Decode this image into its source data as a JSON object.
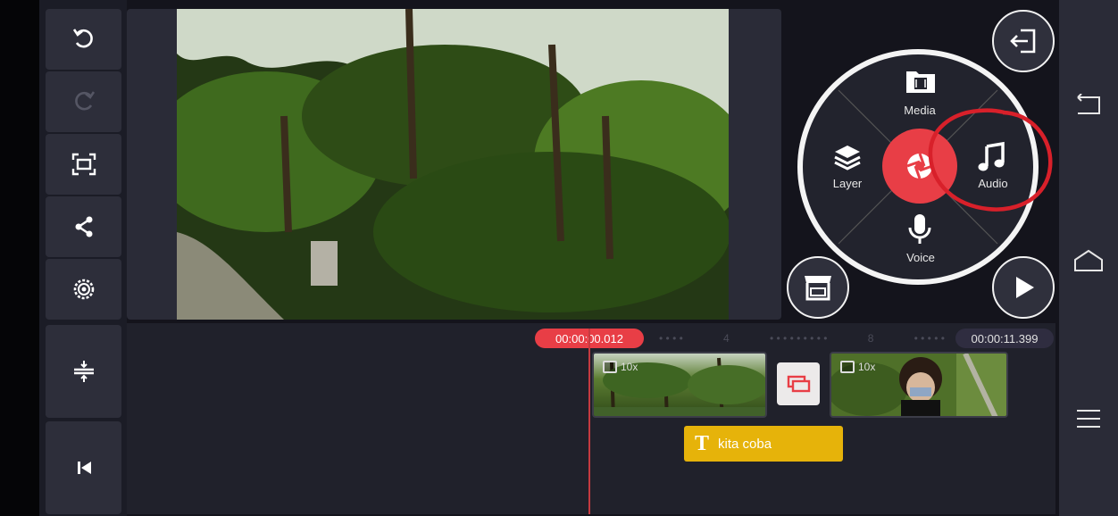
{
  "left_toolbar": {
    "buttons": [
      {
        "name": "undo-button",
        "icon": "undo-icon"
      },
      {
        "name": "redo-button",
        "icon": "redo-icon",
        "disabled": true
      },
      {
        "name": "aspect-ratio-button",
        "icon": "fullscreen-icon"
      },
      {
        "name": "share-button",
        "icon": "share-icon"
      },
      {
        "name": "settings-button",
        "icon": "gear-icon"
      }
    ]
  },
  "radial_menu": {
    "media_label": "Media",
    "audio_label": "Audio",
    "layer_label": "Layer",
    "voice_label": "Voice",
    "center_icon": "camera-shutter-icon",
    "annotation_color": "#d8202a"
  },
  "corner_buttons": {
    "exit_icon": "exit-icon",
    "store_icon": "store-icon",
    "play_icon": "play-icon"
  },
  "system_nav": {
    "back_icon": "back-icon",
    "home_icon": "home-icon",
    "menu_icon": "menu-icon"
  },
  "timeline": {
    "current_time": "00:00:00.012",
    "total_time": "00:00:11.399",
    "ruler_marks": [
      "4",
      "8"
    ],
    "clips": [
      {
        "speed": "10x"
      },
      {
        "speed": "10x"
      }
    ],
    "text_clip_label": "kita coba",
    "text_clip_icon": "T",
    "transition_icon": "transition-icon",
    "accent_color": "#e83e46",
    "text_clip_color": "#e6b30a"
  }
}
